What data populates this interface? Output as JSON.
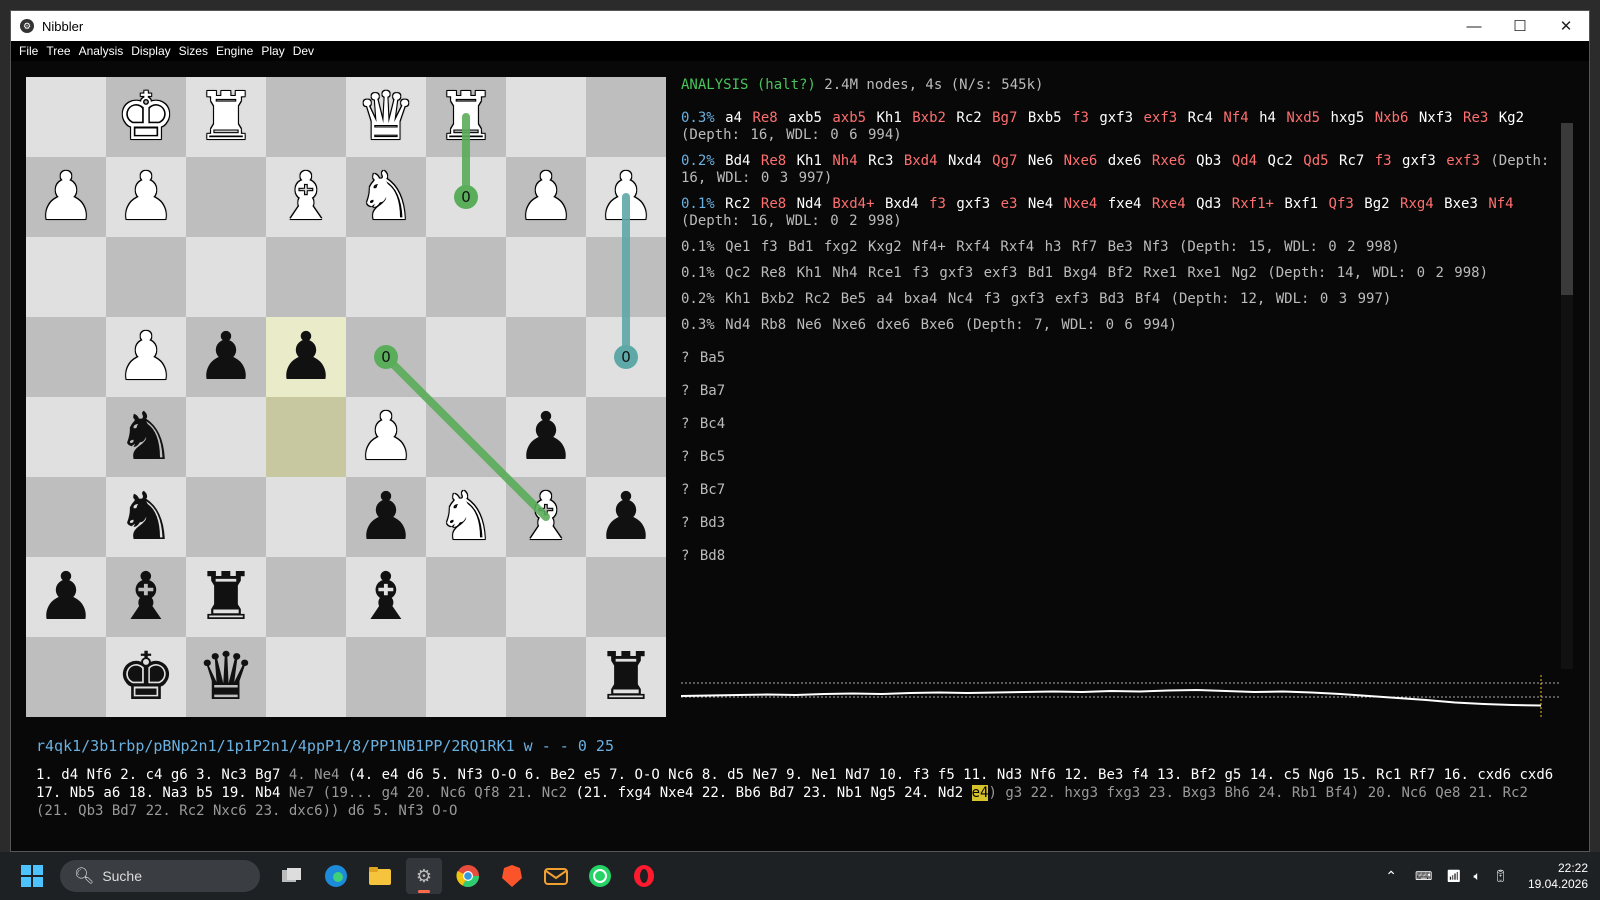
{
  "window": {
    "title": "Nibbler",
    "min": "—",
    "max": "☐",
    "close": "✕"
  },
  "menu": [
    "File",
    "Tree",
    "Analysis",
    "Display",
    "Sizes",
    "Engine",
    "Play",
    "Dev"
  ],
  "board": {
    "highlight": [
      "d5",
      "d4"
    ],
    "pieces": [
      {
        "sq": "b8",
        "g": "♚",
        "c": "w"
      },
      {
        "sq": "c8",
        "g": "♜",
        "c": "w"
      },
      {
        "sq": "e8",
        "g": "♛",
        "c": "w"
      },
      {
        "sq": "f8",
        "g": "♜",
        "c": "w"
      },
      {
        "sq": "a7",
        "g": "♟",
        "c": "w"
      },
      {
        "sq": "b7",
        "g": "♟",
        "c": "w"
      },
      {
        "sq": "d7",
        "g": "♝",
        "c": "w"
      },
      {
        "sq": "e7",
        "g": "♞",
        "c": "w"
      },
      {
        "sq": "g7",
        "g": "♟",
        "c": "w"
      },
      {
        "sq": "h7",
        "g": "♟",
        "c": "w"
      },
      {
        "sq": "b5",
        "g": "♟",
        "c": "w"
      },
      {
        "sq": "c5",
        "g": "♟",
        "c": "b"
      },
      {
        "sq": "d5",
        "g": "♟",
        "c": "b"
      },
      {
        "sq": "b4",
        "g": "♞",
        "c": "b"
      },
      {
        "sq": "e4",
        "g": "♟",
        "c": "w"
      },
      {
        "sq": "g4",
        "g": "♟",
        "c": "b"
      },
      {
        "sq": "b3",
        "g": "♞",
        "c": "b"
      },
      {
        "sq": "e3",
        "g": "♟",
        "c": "b"
      },
      {
        "sq": "f3",
        "g": "♞",
        "c": "w"
      },
      {
        "sq": "g3",
        "g": "♝",
        "c": "w"
      },
      {
        "sq": "h3",
        "g": "♟",
        "c": "b"
      },
      {
        "sq": "a2",
        "g": "♟",
        "c": "b"
      },
      {
        "sq": "b2",
        "g": "♝",
        "c": "b"
      },
      {
        "sq": "c2",
        "g": "♜",
        "c": "b"
      },
      {
        "sq": "e2",
        "g": "♝",
        "c": "b"
      },
      {
        "sq": "b1",
        "g": "♚",
        "c": "b"
      },
      {
        "sq": "c1",
        "g": "♛",
        "c": "b"
      },
      {
        "sq": "h1",
        "g": "♜",
        "c": "b"
      }
    ],
    "arrows": [
      {
        "from": "f8",
        "to": "f7",
        "label": "0",
        "color": "#5aad5a"
      },
      {
        "from": "g3",
        "to": "e5",
        "label": "0",
        "color": "#5aad5a"
      },
      {
        "from": "h7",
        "to": "h5",
        "label": "0",
        "color": "#5fa8a8"
      }
    ]
  },
  "analysis": {
    "status_label": "ANALYSIS (halt?)",
    "status_info": " 2.4M nodes, 4s (N/s: 545k)",
    "pv_lines": [
      {
        "pct": "0.3%",
        "moves": [
          [
            "a4",
            "w"
          ],
          [
            "Re8",
            "r"
          ],
          [
            "axb5",
            "w"
          ],
          [
            "axb5",
            "r"
          ],
          [
            "Kh1",
            "w"
          ],
          [
            "Bxb2",
            "r"
          ],
          [
            "Rc2",
            "w"
          ],
          [
            "Bg7",
            "r"
          ],
          [
            "Bxb5",
            "w"
          ],
          [
            "f3",
            "r"
          ],
          [
            "gxf3",
            "w"
          ],
          [
            "exf3",
            "r"
          ],
          [
            "Rc4",
            "w"
          ],
          [
            "Nf4",
            "r"
          ],
          [
            "h4",
            "w"
          ],
          [
            "Nxd5",
            "r"
          ],
          [
            "hxg5",
            "w"
          ],
          [
            "Nxb6",
            "r"
          ],
          [
            "Nxf3",
            "w"
          ],
          [
            "Re3",
            "r"
          ],
          [
            "Kg2",
            "w"
          ]
        ],
        "info": "(Depth: 16, WDL: 0 6 994)"
      },
      {
        "pct": "0.2%",
        "moves": [
          [
            "Bd4",
            "w"
          ],
          [
            "Re8",
            "r"
          ],
          [
            "Kh1",
            "w"
          ],
          [
            "Nh4",
            "r"
          ],
          [
            "Rc3",
            "w"
          ],
          [
            "Bxd4",
            "r"
          ],
          [
            "Nxd4",
            "w"
          ],
          [
            "Qg7",
            "r"
          ],
          [
            "Ne6",
            "w"
          ],
          [
            "Nxe6",
            "r"
          ],
          [
            "dxe6",
            "w"
          ],
          [
            "Rxe6",
            "r"
          ],
          [
            "Qb3",
            "w"
          ],
          [
            "Qd4",
            "r"
          ],
          [
            "Qc2",
            "w"
          ],
          [
            "Qd5",
            "r"
          ],
          [
            "Rc7",
            "w"
          ],
          [
            "f3",
            "r"
          ],
          [
            "gxf3",
            "w"
          ],
          [
            "exf3",
            "r"
          ]
        ],
        "info": "(Depth: 16, WDL: 0 3 997)"
      },
      {
        "pct": "0.1%",
        "moves": [
          [
            "Rc2",
            "w"
          ],
          [
            "Re8",
            "r"
          ],
          [
            "Nd4",
            "w"
          ],
          [
            "Bxd4+",
            "r"
          ],
          [
            "Bxd4",
            "w"
          ],
          [
            "f3",
            "r"
          ],
          [
            "gxf3",
            "w"
          ],
          [
            "e3",
            "r"
          ],
          [
            "Ne4",
            "w"
          ],
          [
            "Nxe4",
            "r"
          ],
          [
            "fxe4",
            "w"
          ],
          [
            "Rxe4",
            "r"
          ],
          [
            "Qd3",
            "w"
          ],
          [
            "Rxf1+",
            "r"
          ],
          [
            "Bxf1",
            "w"
          ],
          [
            "Qf3",
            "r"
          ],
          [
            "Bg2",
            "w"
          ],
          [
            "Rxg4",
            "r"
          ],
          [
            "Bxe3",
            "w"
          ],
          [
            "Nf4",
            "r"
          ]
        ],
        "info": "(Depth: 16, WDL: 0 2 998)"
      }
    ],
    "dim_lines": [
      "0.1% Qe1 f3 Bd1 fxg2 Kxg2 Nf4+ Rxf4 Rxf4 h3 Rf7 Be3 Nf3 (Depth: 15, WDL: 0 2 998)",
      "0.1% Qc2 Re8 Kh1 Nh4 Rce1 f3 gxf3 exf3 Bd1 Bxg4 Bf2 Rxe1 Rxe1 Ng2 (Depth: 14, WDL: 0 2 998)",
      "0.2% Kh1 Bxb2 Rc2 Be5 a4 bxa4 Nc4 f3 gxf3 exf3 Bd3 Bf4 (Depth: 12, WDL: 0 3 997)",
      "0.3% Nd4 Rb8 Ne6 Nxe6 dxe6 Bxe6 (Depth: 7, WDL: 0 6 994)"
    ],
    "unexplored": [
      "? Ba5",
      "? Ba7",
      "? Bc4",
      "? Bc5",
      "? Bc7",
      "? Bd3",
      "? Bd8"
    ]
  },
  "graph": {
    "values": [
      0.42,
      0.41,
      0.4,
      0.39,
      0.4,
      0.38,
      0.37,
      0.38,
      0.36,
      0.35,
      0.36,
      0.35,
      0.34,
      0.33,
      0.34,
      0.32,
      0.33,
      0.31,
      0.3,
      0.32,
      0.34,
      0.33,
      0.35,
      0.38,
      0.42,
      0.46,
      0.5,
      0.55,
      0.58,
      0.6,
      0.61
    ]
  },
  "fen": "r4qk1/3b1rbp/pBNp2n1/1p1P2n1/4ppP1/8/PP1NB1PP/2RQ1RK1 w - - 0 25",
  "movelist": {
    "main1": "1. d4 Nf6 2. c4 g6 3. Nc3 Bg7 ",
    "gray1": "4. Ne4",
    "var1": " (4. e4 d6 5. Nf3 O-O 6. Be2 e5 7. O-O Nc6 8. d5 Ne7 9. Ne1 Nd7 10. f3 f5 11. Nd3 Nf6 12. Be3 f4 13. Bf2 g5 14. c5 Ng6 15. Rc1 Rf7 16. cxd6 cxd6 17. Nb5 a6 18. Na3 b5 19. Nb4 ",
    "gray2": "Ne7 (19... g4 20. Nc6 Qf8 21. Nc2 ",
    "var2": "(21. fxg4 Nxe4 22. Bb6 Bd7 23. Nb1 Ng5 24. Nd2 ",
    "current": "e4",
    "gray3": ") g3 22. hxg3 fxg3 23. Bxg3 Bh6 24. Rb1 Bf4) 20. Nc6 Qe8 21. Rc2 (21. Qb3 Bd7 22. Rc2 Nxc6 23. dxc6)) d6 5. Nf3 O-O"
  },
  "taskbar": {
    "search": "Suche",
    "time": "22:22",
    "date": "19.04.2026"
  }
}
